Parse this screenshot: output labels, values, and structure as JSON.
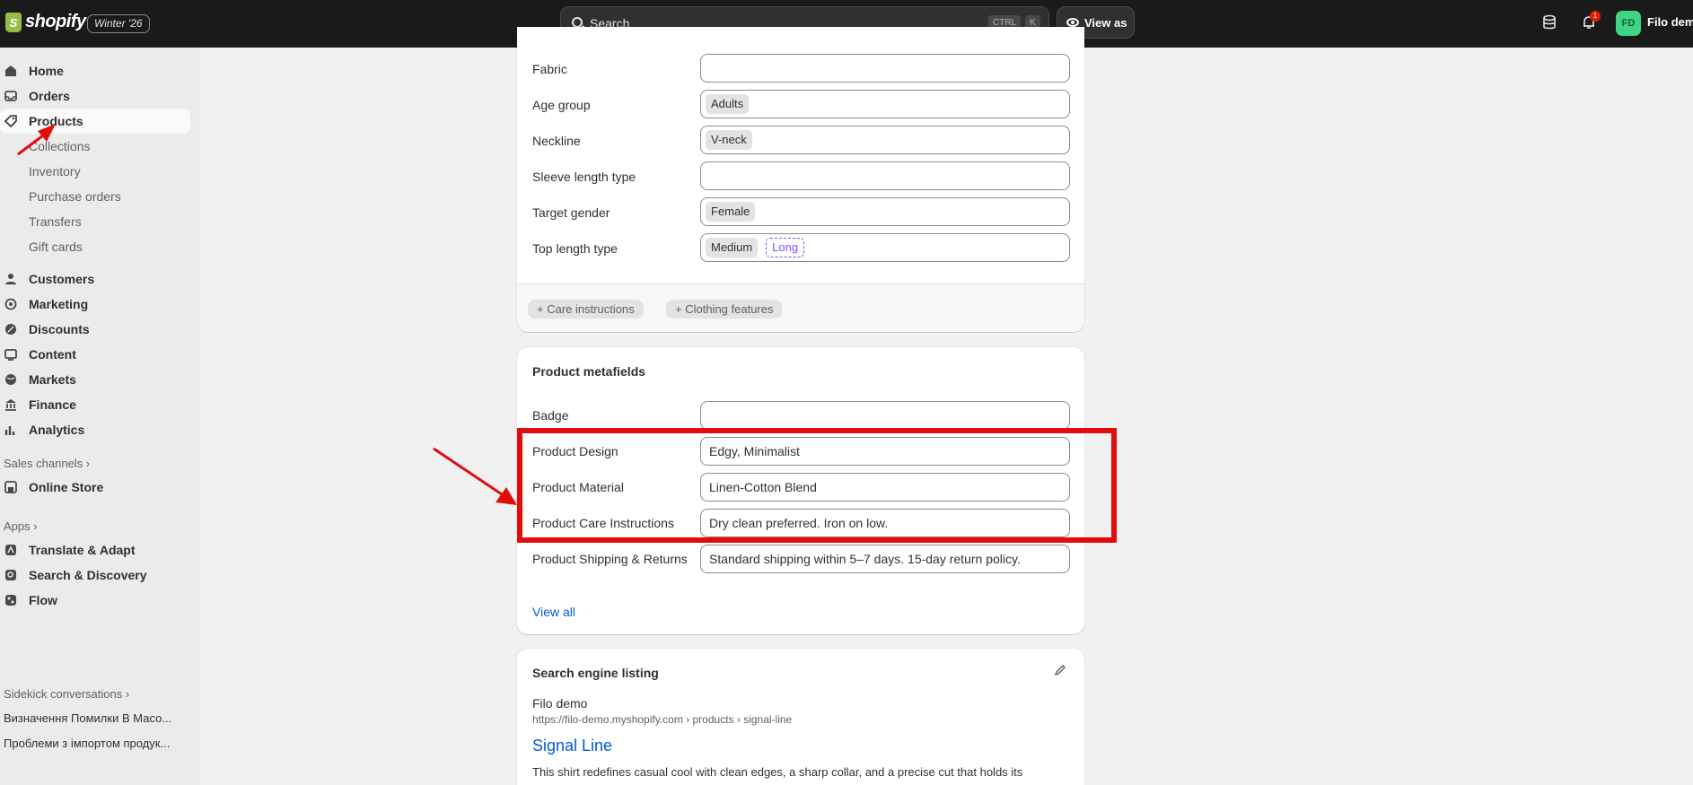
{
  "topbar": {
    "brand": "shopify",
    "edition": "Winter '26",
    "search_placeholder": "Search",
    "shortcut_ctrl": "CTRL",
    "shortcut_k": "K",
    "view_as": "View as",
    "notification_count": "1",
    "avatar_initials": "FD",
    "store_name": "Filo demo"
  },
  "sidebar": {
    "items": [
      {
        "label": "Home",
        "icon": "home-icon"
      },
      {
        "label": "Orders",
        "icon": "inbox-icon"
      },
      {
        "label": "Products",
        "icon": "tag-icon"
      },
      {
        "label": "Customers",
        "icon": "person-icon"
      },
      {
        "label": "Marketing",
        "icon": "target-icon"
      },
      {
        "label": "Discounts",
        "icon": "discount-icon"
      },
      {
        "label": "Content",
        "icon": "content-icon"
      },
      {
        "label": "Markets",
        "icon": "globe-icon"
      },
      {
        "label": "Finance",
        "icon": "bank-icon"
      },
      {
        "label": "Analytics",
        "icon": "chart-icon"
      }
    ],
    "product_subitems": [
      "Collections",
      "Inventory",
      "Purchase orders",
      "Transfers",
      "Gift cards"
    ],
    "sales_channels_label": "Sales channels",
    "online_store": "Online Store",
    "apps_label": "Apps",
    "apps": [
      "Translate & Adapt",
      "Search & Discovery",
      "Flow"
    ],
    "sidekick_label": "Sidekick conversations",
    "conversations": [
      "Визначення Помилки В Масо...",
      "Проблеми з імпортом продук..."
    ]
  },
  "category_card": {
    "rows": [
      {
        "label": "Fabric",
        "tags": []
      },
      {
        "label": "Age group",
        "tags": [
          "Adults"
        ]
      },
      {
        "label": "Neckline",
        "tags": [
          "V-neck"
        ]
      },
      {
        "label": "Sleeve length type",
        "tags": []
      },
      {
        "label": "Target gender",
        "tags": [
          "Female"
        ]
      },
      {
        "label": "Top length type",
        "tags": [
          "Medium"
        ],
        "suggested": "Long"
      }
    ],
    "add_buttons": [
      "+ Care instructions",
      "+ Clothing features"
    ]
  },
  "metafields_card": {
    "title": "Product metafields",
    "rows": [
      {
        "label": "Badge",
        "value": ""
      },
      {
        "label": "Product Design",
        "value": "Edgy, Minimalist"
      },
      {
        "label": "Product Material",
        "value": "Linen-Cotton Blend"
      },
      {
        "label": "Product Care Instructions",
        "value": "Dry clean preferred. Iron on low."
      },
      {
        "label": "Product Shipping & Returns",
        "value": "Standard shipping within 5–7 days. 15-day return policy."
      }
    ],
    "view_all": "View all"
  },
  "seo_card": {
    "title": "Search engine listing",
    "store": "Filo demo",
    "url": "https://filo-demo.myshopify.com › products › signal-line",
    "page_title": "Signal Line",
    "description": "This shirt redefines casual cool with clean edges, a sharp collar, and a precise cut that holds its"
  },
  "colors": {
    "accent_link": "#005bd3",
    "annotation_red": "#e10d0d",
    "suggestion_purple": "#8051ff"
  }
}
